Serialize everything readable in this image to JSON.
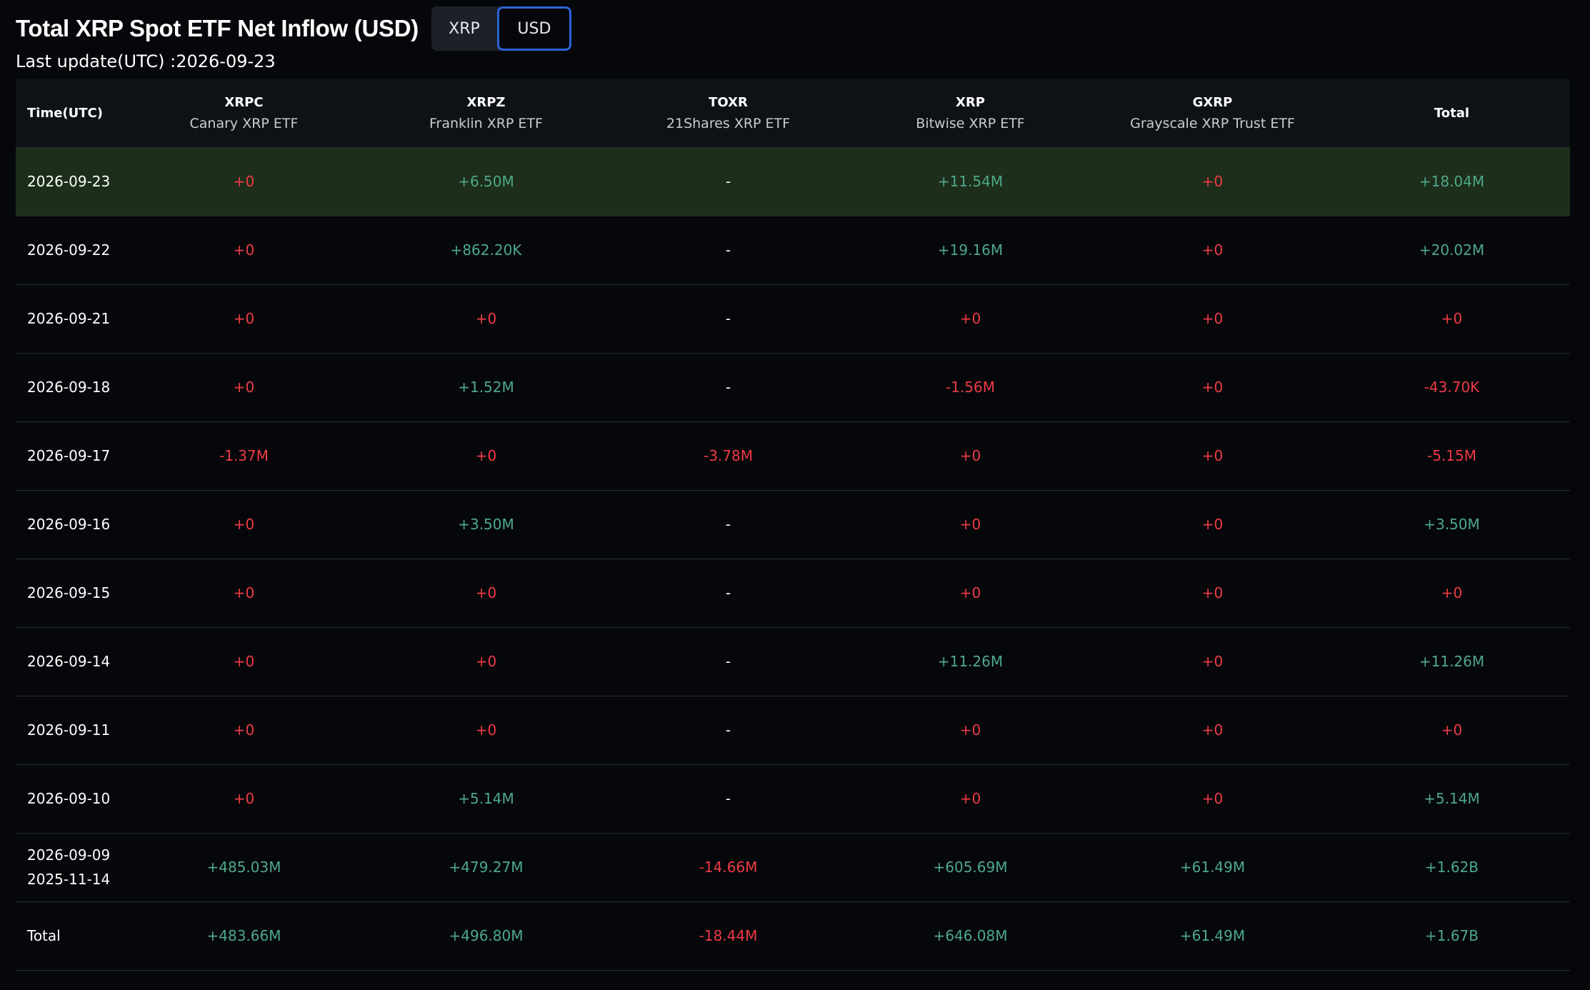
{
  "header": {
    "title": "Total XRP Spot ETF Net Inflow (USD)",
    "units": [
      "XRP",
      "USD"
    ],
    "active_unit": "USD",
    "last_update": "Last update(UTC) :2026-09-23"
  },
  "table": {
    "time_header": "Time(UTC)",
    "total_header": "Total",
    "columns": [
      {
        "ticker": "XRPC",
        "name": "Canary XRP ETF"
      },
      {
        "ticker": "XRPZ",
        "name": "Franklin XRP ETF"
      },
      {
        "ticker": "TOXR",
        "name": "21Shares XRP ETF"
      },
      {
        "ticker": "XRP",
        "name": "Bitwise XRP ETF"
      },
      {
        "ticker": "GXRP",
        "name": "Grayscale XRP Trust ETF"
      }
    ],
    "rows": [
      {
        "date": "2026-09-23",
        "date2": "",
        "values": [
          "+0",
          "+6.50M",
          "-",
          "+11.54M",
          "+0"
        ],
        "total": "+18.04M"
      },
      {
        "date": "2026-09-22",
        "date2": "",
        "values": [
          "+0",
          "+862.20K",
          "-",
          "+19.16M",
          "+0"
        ],
        "total": "+20.02M"
      },
      {
        "date": "2026-09-21",
        "date2": "",
        "values": [
          "+0",
          "+0",
          "-",
          "+0",
          "+0"
        ],
        "total": "+0"
      },
      {
        "date": "2026-09-18",
        "date2": "",
        "values": [
          "+0",
          "+1.52M",
          "-",
          "-1.56M",
          "+0"
        ],
        "total": "-43.70K"
      },
      {
        "date": "2026-09-17",
        "date2": "",
        "values": [
          "-1.37M",
          "+0",
          "-3.78M",
          "+0",
          "+0"
        ],
        "total": "-5.15M"
      },
      {
        "date": "2026-09-16",
        "date2": "",
        "values": [
          "+0",
          "+3.50M",
          "-",
          "+0",
          "+0"
        ],
        "total": "+3.50M"
      },
      {
        "date": "2026-09-15",
        "date2": "",
        "values": [
          "+0",
          "+0",
          "-",
          "+0",
          "+0"
        ],
        "total": "+0"
      },
      {
        "date": "2026-09-14",
        "date2": "",
        "values": [
          "+0",
          "+0",
          "-",
          "+11.26M",
          "+0"
        ],
        "total": "+11.26M"
      },
      {
        "date": "2026-09-11",
        "date2": "",
        "values": [
          "+0",
          "+0",
          "-",
          "+0",
          "+0"
        ],
        "total": "+0"
      },
      {
        "date": "2026-09-10",
        "date2": "",
        "values": [
          "+0",
          "+5.14M",
          "-",
          "+0",
          "+0"
        ],
        "total": "+5.14M"
      },
      {
        "date": "2026-09-09",
        "date2": "2025-11-14",
        "values": [
          "+485.03M",
          "+479.27M",
          "-14.66M",
          "+605.69M",
          "+61.49M"
        ],
        "total": "+1.62B"
      },
      {
        "date": "Total",
        "date2": "",
        "values": [
          "+483.66M",
          "+496.80M",
          "-18.44M",
          "+646.08M",
          "+61.49M"
        ],
        "total": "+1.67B"
      }
    ]
  },
  "colors": {
    "positive": "#4ea88a",
    "zero": "#ee3b45",
    "negative": "#ee3b45",
    "highlight_row": "#1d2e1b",
    "toggle_active_border": "#2b63d6"
  }
}
